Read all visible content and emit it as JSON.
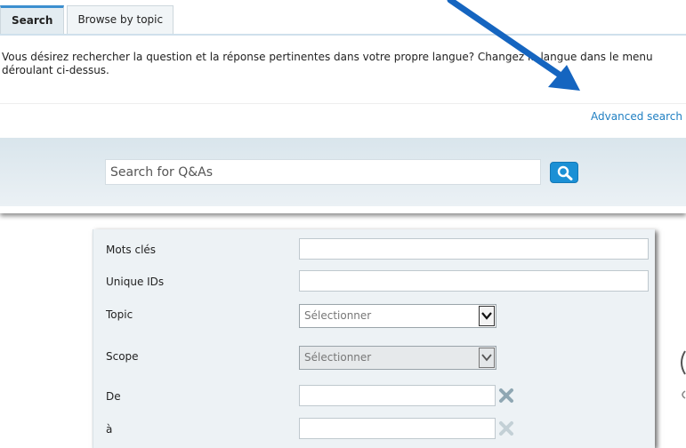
{
  "tabs": [
    {
      "label": "Search",
      "active": true
    },
    {
      "label": "Browse by topic",
      "active": false
    }
  ],
  "intro_text": "Vous désirez rechercher la question et la réponse pertinentes dans votre propre langue? Changez la langue dans le menu déroulant ci-dessus.",
  "advanced_search_label": "Advanced search",
  "search": {
    "placeholder": "Search for Q&As"
  },
  "form": {
    "keywords_label": "Mots clés",
    "unique_ids_label": "Unique IDs",
    "topic_label": "Topic",
    "topic_selected": "Sélectionner",
    "scope_label": "Scope",
    "scope_selected": "Sélectionner",
    "from_label": "De",
    "to_label": "à"
  },
  "colors": {
    "accent": "#1b90d5",
    "link": "#1f7fc2",
    "annotation_arrow": "#1565c0"
  },
  "icons": {
    "search_button": "magnifier-icon",
    "dropdown": "chevron-down-icon",
    "clear": "clear-x-icon",
    "annotation": "arrow-pointer-icon"
  }
}
